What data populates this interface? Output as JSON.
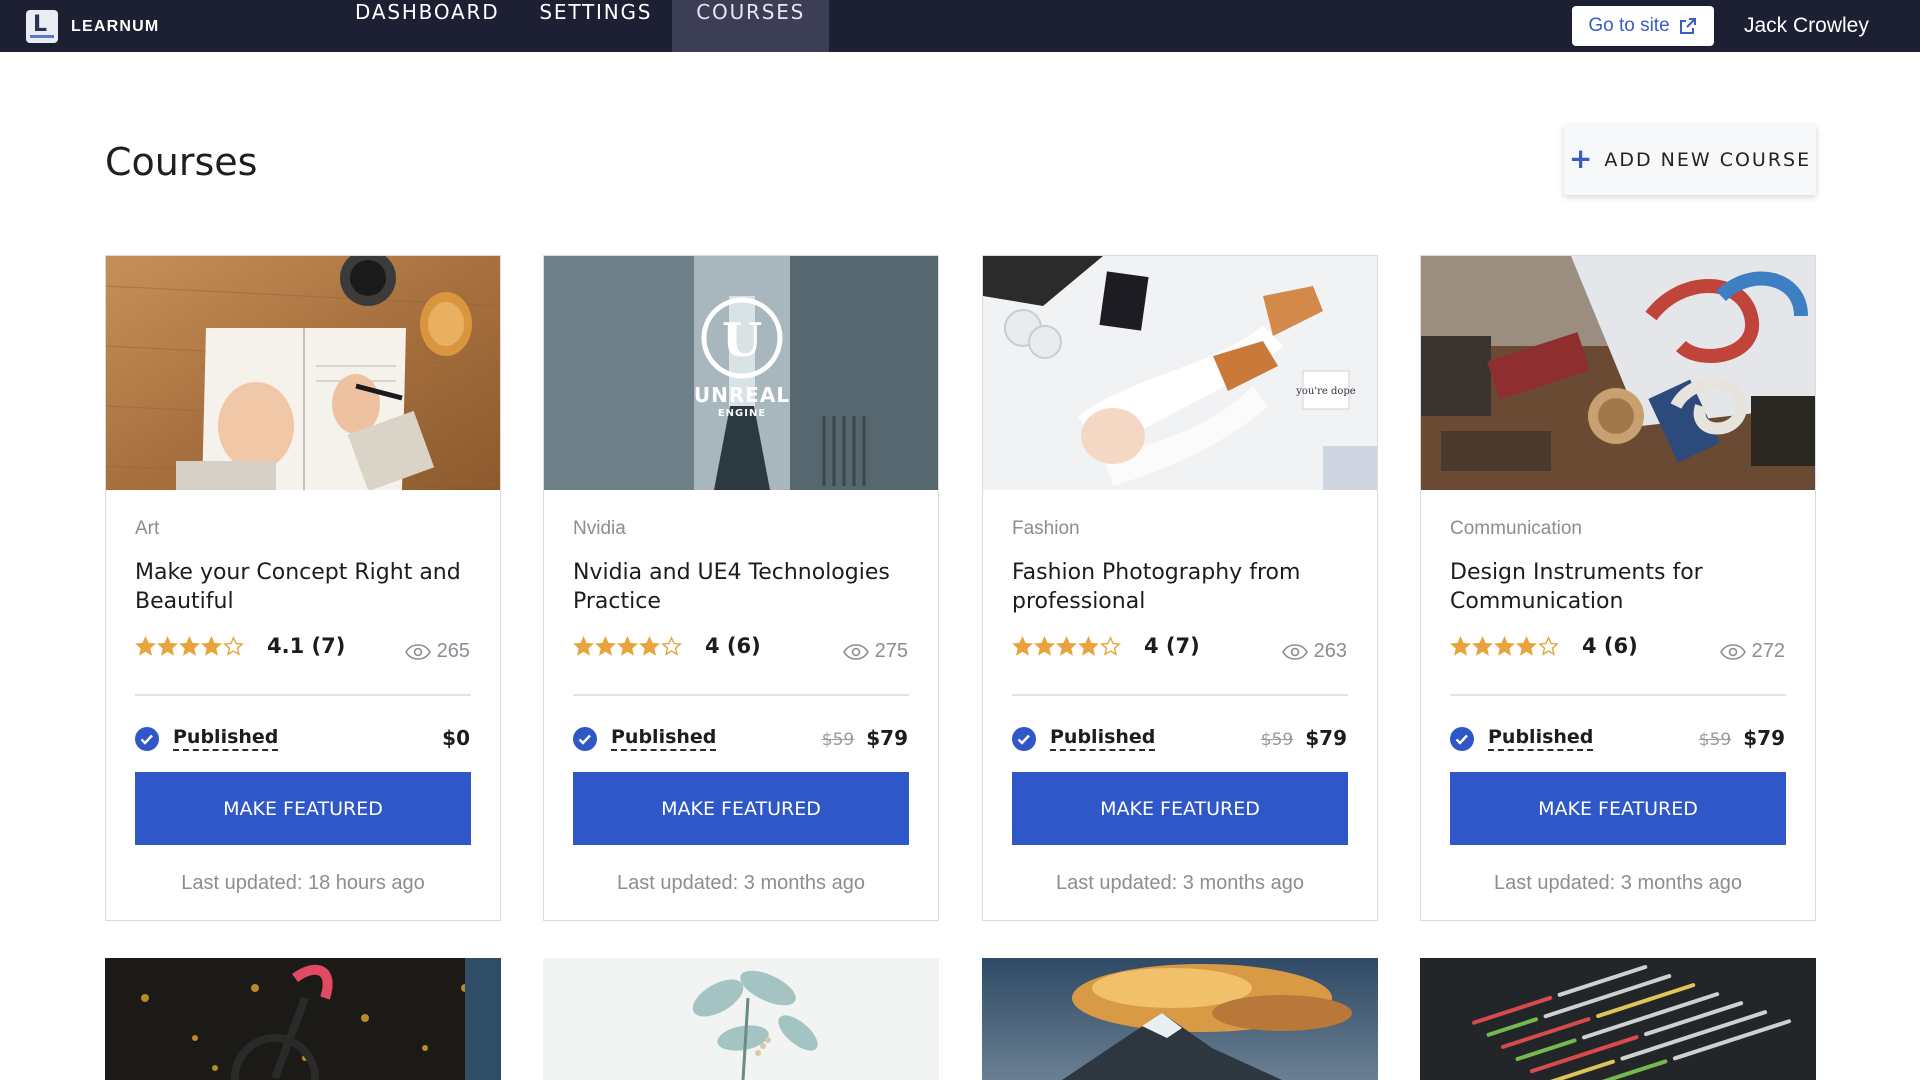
{
  "brand": {
    "logo_letter": "L",
    "name": "LEARNUM"
  },
  "nav": [
    {
      "label": "DASHBOARD",
      "active": false
    },
    {
      "label": "SETTINGS",
      "active": false
    },
    {
      "label": "COURSES",
      "active": true
    }
  ],
  "header_actions": {
    "goto_label": "Go to site",
    "user_name": "Jack Crowley"
  },
  "page": {
    "title": "Courses",
    "add_button_label": "ADD NEW COURSE"
  },
  "colors": {
    "topbar": "#1d1f32",
    "accent": "#2f57c7",
    "star": "#e8a33c"
  },
  "courses": [
    {
      "category": "Art",
      "title": "Make your Concept Right and Beautiful",
      "rating": "4.1 (7)",
      "stars": 4,
      "views": "265",
      "status": "Published",
      "old_price": "",
      "price": "$0",
      "button": "MAKE FEATURED",
      "updated": "Last updated: 18 hours ago"
    },
    {
      "category": "Nvidia",
      "title": "Nvidia and UE4 Technologies Practice",
      "rating": "4 (6)",
      "stars": 4,
      "views": "275",
      "status": "Published",
      "old_price": "$59",
      "price": "$79",
      "button": "MAKE FEATURED",
      "updated": "Last updated: 3 months ago"
    },
    {
      "category": "Fashion",
      "title": "Fashion Photography from professional",
      "rating": "4 (7)",
      "stars": 4,
      "views": "263",
      "status": "Published",
      "old_price": "$59",
      "price": "$79",
      "button": "MAKE FEATURED",
      "updated": "Last updated: 3 months ago"
    },
    {
      "category": "Communication",
      "title": "Design Instruments for Communication",
      "rating": "4 (6)",
      "stars": 4,
      "views": "272",
      "status": "Published",
      "old_price": "$59",
      "price": "$79",
      "button": "MAKE FEATURED",
      "updated": "Last updated: 3 months ago"
    }
  ],
  "thumb_texts": {
    "unreal_line1": "UNREAL",
    "unreal_line2": "ENGINE",
    "unreal_logo": "U",
    "fashion_card": "you're dope"
  }
}
